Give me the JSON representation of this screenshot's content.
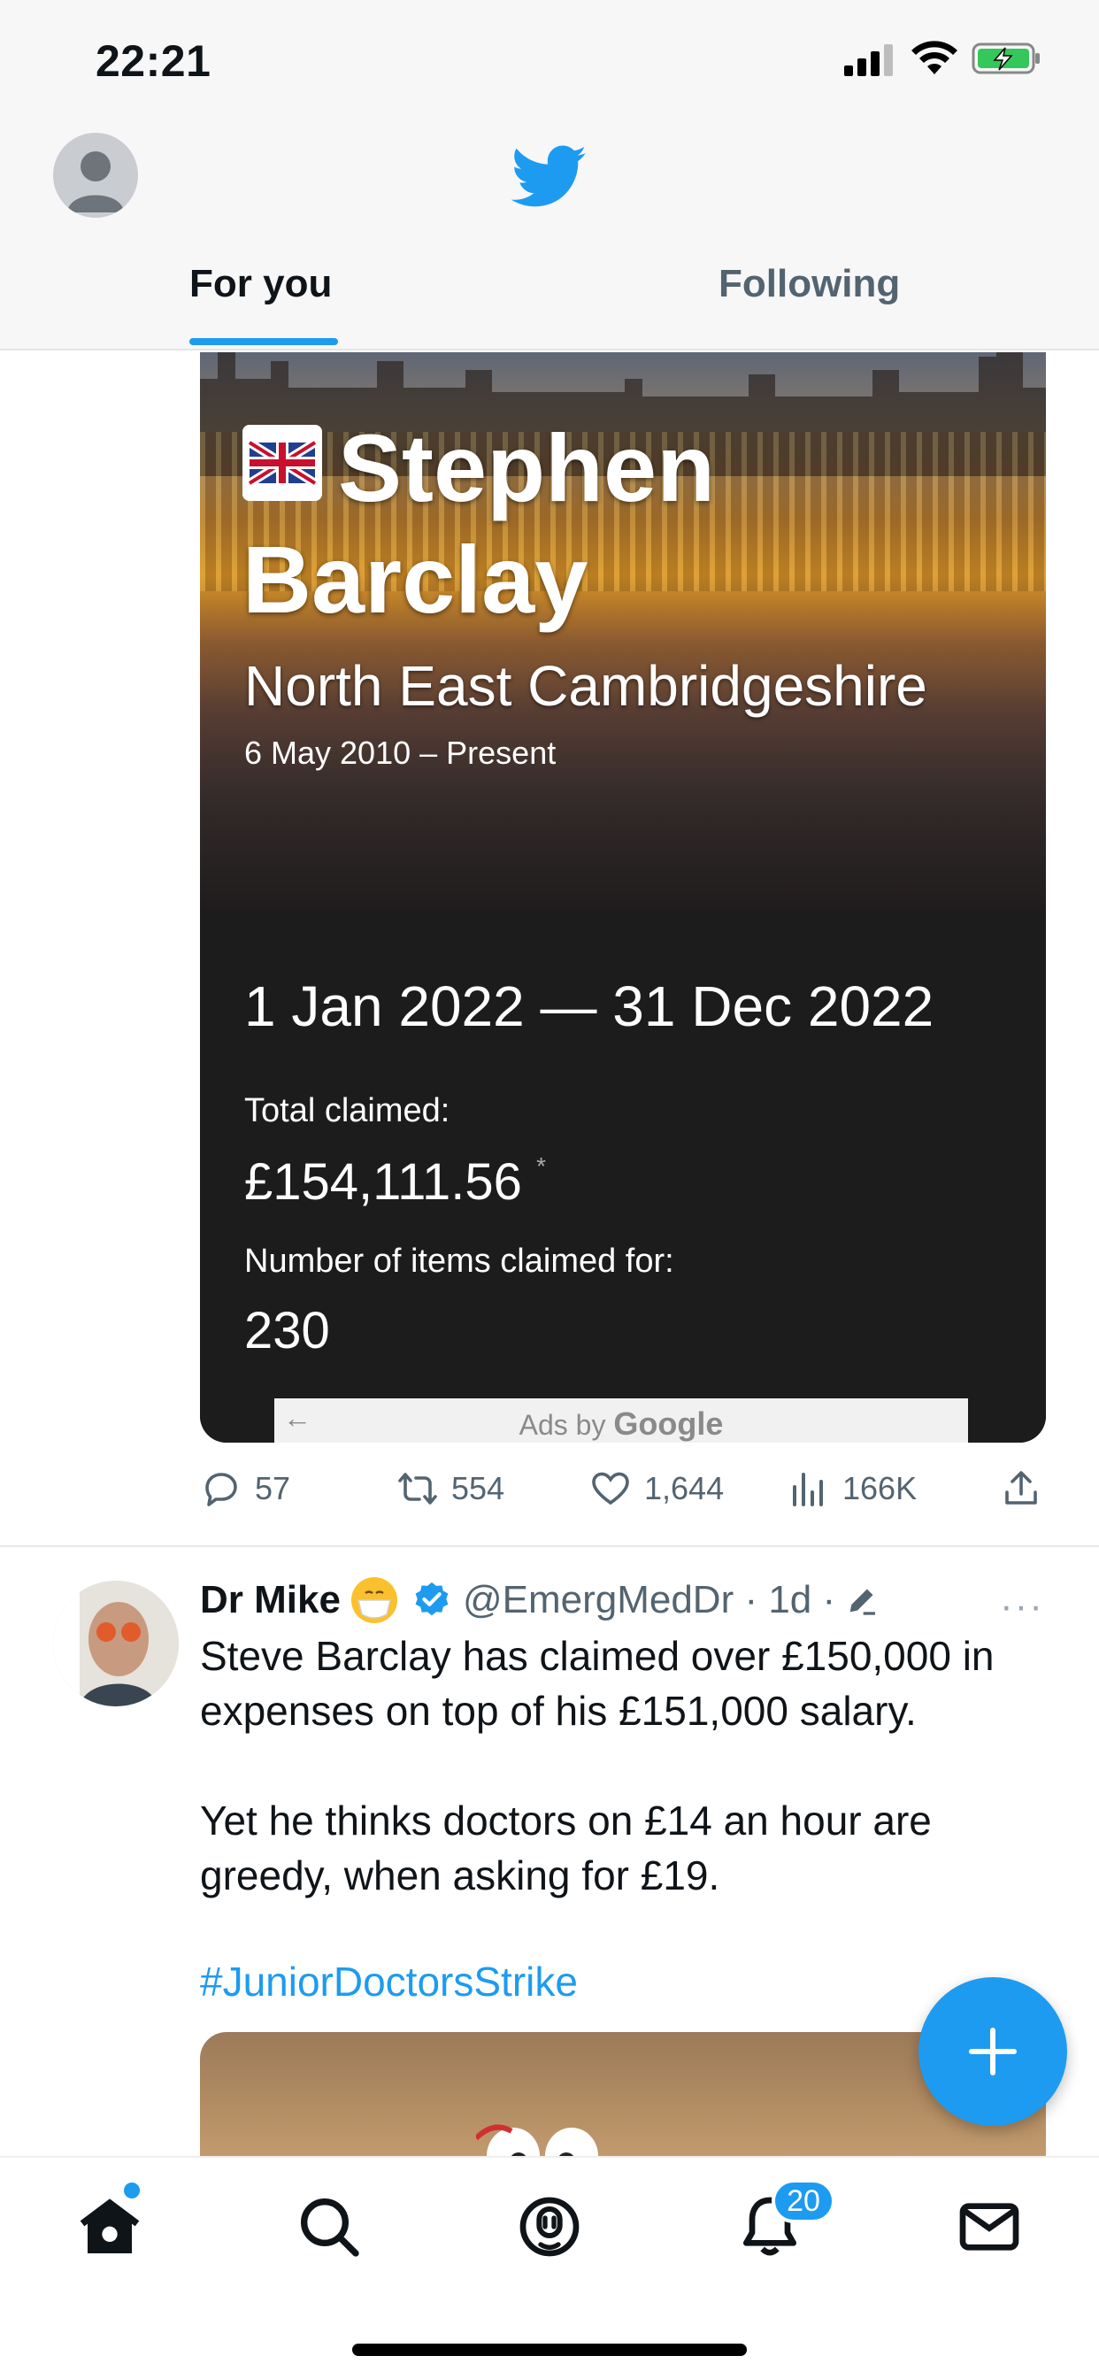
{
  "status_bar": {
    "time": "22:21",
    "icons": [
      "cellular-signal-icon",
      "wifi-icon",
      "battery-charging-icon"
    ]
  },
  "header": {
    "logo": "twitter-bird-icon",
    "tabs": [
      {
        "label": "For you",
        "active": true
      },
      {
        "label": "Following",
        "active": false
      }
    ]
  },
  "card": {
    "name": "Stephen Barclay",
    "constituency": "North East Cambridgeshire",
    "term": "6 May 2010 – Present",
    "date_range": "1 Jan 2022 — 31 Dec 2022",
    "total_label": "Total claimed:",
    "total_value": "£154,111.56",
    "asterisk": "*",
    "items_label": "Number of items claimed for:",
    "items_value": "230",
    "ad_prefix": "Ads by",
    "ad_brand": "Google"
  },
  "tweet1_actions": {
    "replies": "57",
    "retweets": "554",
    "likes": "1,644",
    "views": "166K"
  },
  "tweet2": {
    "name": "Dr Mike",
    "handle_time": "@EmergMedDr · 1d ·",
    "paragraph1": "Steve Barclay has claimed over £150,000 in expenses on top of his £151,000 salary.",
    "paragraph2": "Yet he thinks doctors on £14 an hour are greedy, when asking for £19.",
    "hashtag": "#JuniorDoctorsStrike",
    "more": "···"
  },
  "bottom_nav": {
    "items": [
      "home-icon",
      "search-icon",
      "spaces-icon",
      "notifications-icon",
      "messages-icon"
    ],
    "notification_count": "20"
  },
  "colors": {
    "accent": "#1d9bf0",
    "text_primary": "#0f1419",
    "text_secondary": "#536471"
  }
}
